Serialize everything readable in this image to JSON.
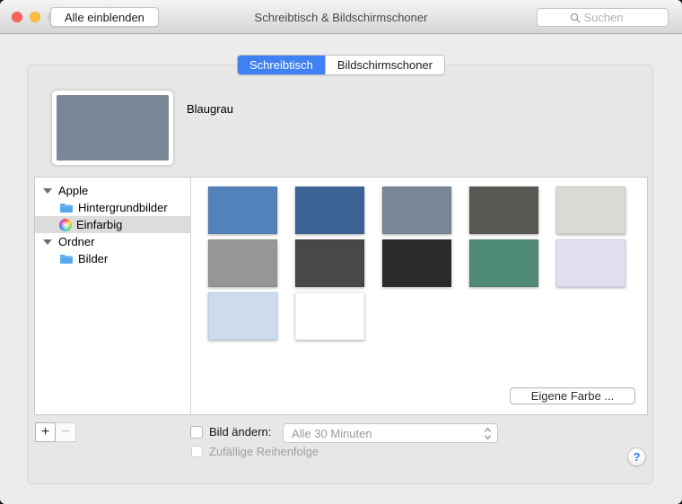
{
  "titlebar": {
    "title": "Schreibtisch & Bildschirmschoner",
    "show_all_button": "Alle einblenden",
    "search_placeholder": "Suchen"
  },
  "tabs": {
    "desktop": "Schreibtisch",
    "screensaver": "Bildschirmschoner"
  },
  "preview": {
    "label": "Blaugrau",
    "color": "#7b8796"
  },
  "sidebar": {
    "groups": [
      {
        "label": "Apple",
        "items": [
          {
            "label": "Hintergrundbilder",
            "icon": "folder-icon",
            "selected": false
          },
          {
            "label": "Einfarbig",
            "icon": "color-wheel-icon",
            "selected": true
          }
        ]
      },
      {
        "label": "Ordner",
        "items": [
          {
            "label": "Bilder",
            "icon": "folder-icon",
            "selected": false
          }
        ]
      }
    ]
  },
  "swatches": {
    "grid": [
      {
        "color": "#5381b9"
      },
      {
        "color": "#3c6595"
      },
      {
        "color": "#7b8696"
      },
      {
        "color": "#5a5954"
      },
      {
        "color": "#d9d9d6"
      },
      {
        "color": "#969696"
      },
      {
        "color": "#484848"
      },
      {
        "color": "#2b2b2b"
      },
      {
        "color": "#4f8a78"
      },
      {
        "color": "#e3def2"
      },
      {
        "color": "#ccdcec"
      },
      {
        "color": "#ffffff"
      }
    ],
    "custom_color_button": "Eigene Farbe ..."
  },
  "controls": {
    "add_button": "+",
    "remove_button": "−",
    "change_picture_label": "Bild ändern:",
    "interval_selected": "Alle 30 Minuten",
    "random_order_label": "Zufällige Reihenfolge",
    "help_button": "?"
  },
  "colors": {
    "accent_blue": "#3f81f2",
    "traffic_red": "#fc615d",
    "traffic_yellow": "#fdbd40",
    "traffic_disabled": "#d5d5d5"
  }
}
